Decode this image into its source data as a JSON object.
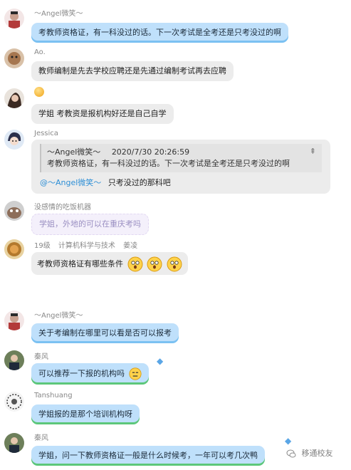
{
  "messages": [
    {
      "sender": "～Angel微笑～",
      "text": "考教师资格证，有一科没过的话。下一次考试是全考还是只考没过的啊",
      "style": "blue"
    },
    {
      "sender": "Ao.",
      "text": "教师编制是先去学校应聘还是先通过编制考试再去应聘",
      "style": "gray"
    },
    {
      "sender": "",
      "text": "学姐 考教资是报机构好还是自己自学",
      "style": "gray"
    },
    {
      "sender": "Jessica",
      "quote": {
        "author": "～Angel微笑～",
        "time": "2020/7/30 20:26:59",
        "text": "考教师资格证，有一科没过的话。下一次考试是全考还是只考没过的啊"
      },
      "mention": "@～Angel微笑～",
      "reply": "只考没过的那科吧",
      "style": "gray"
    },
    {
      "sender": "没感情的吃饭机器",
      "text": "学姐，外地的可以在重庆考吗",
      "style": "lilac"
    },
    {
      "sender_tags": [
        "19级",
        "计算机科学与技术",
        "姜凌"
      ],
      "text": "考教师资格证有哪些条件",
      "style": "gray"
    },
    {
      "sender": "～Angel微笑～",
      "text": "关于考编制在哪里可以看是否可以报考",
      "style": "blue"
    },
    {
      "sender": "秦风",
      "text": "可以推荐一下报的机构吗",
      "style": "blue"
    },
    {
      "sender": "Tanshuang",
      "text": "学姐报的是那个培训机构呀",
      "style": "blue"
    },
    {
      "sender": "秦风",
      "text": "学姐，问一下教师资格证一般是什么时候考，一年可以考几次鸭",
      "style": "blue"
    }
  ],
  "watermark": "移通校友",
  "colors": {
    "blue_bubble": "#bfe0fb",
    "gray_bubble": "#ececec",
    "mention": "#2e8fd6"
  }
}
